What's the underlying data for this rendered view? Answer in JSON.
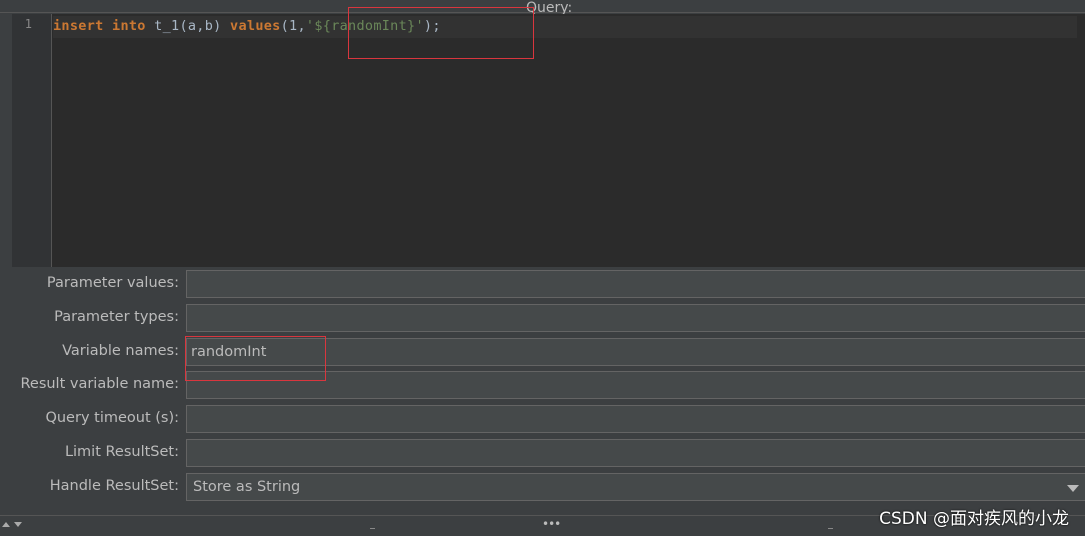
{
  "query": {
    "title": "Query:",
    "line_number": "1",
    "code": {
      "kw_insert": "insert",
      "kw_into": "into",
      "table": "t_1(a,b)",
      "kw_values": "values",
      "args_open": "(1,",
      "string_literal": "'${randomInt}'",
      "args_close": ");"
    }
  },
  "form": {
    "parameter_values": {
      "label": "Parameter values:",
      "value": ""
    },
    "parameter_types": {
      "label": "Parameter types:",
      "value": ""
    },
    "variable_names": {
      "label": "Variable names:",
      "value": "randomInt"
    },
    "result_variable_name": {
      "label": "Result variable name:",
      "value": ""
    },
    "query_timeout": {
      "label": "Query timeout (s):",
      "value": ""
    },
    "limit_resultset": {
      "label": "Limit ResultSet:",
      "value": ""
    },
    "handle_resultset": {
      "label": "Handle ResultSet:",
      "selected": "Store as String"
    }
  },
  "bottom_bar": {
    "dots": "•••"
  },
  "watermark": "CSDN @面对疾风的小龙",
  "colors": {
    "keyword": "#cc7832",
    "string": "#6a8759",
    "highlight_box": "#d9363e",
    "background": "#3c3f41",
    "editor_bg": "#2b2b2b"
  }
}
